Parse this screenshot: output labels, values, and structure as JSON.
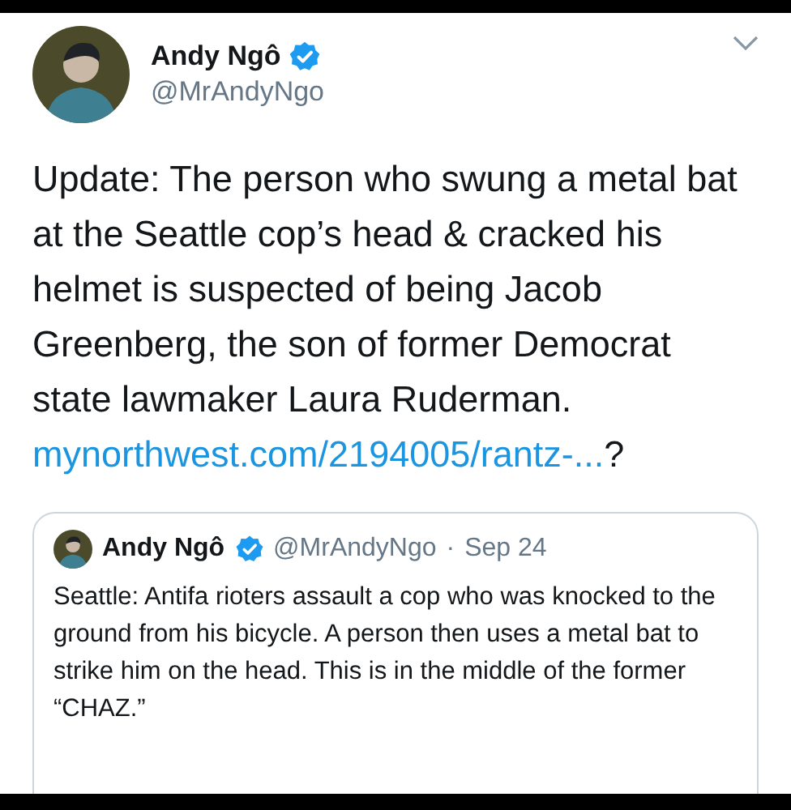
{
  "tweet": {
    "author": {
      "name": "Andy Ngô",
      "handle": "@MrAndyNgo",
      "verified": true
    },
    "text": "Update: The person who swung a metal bat at the Seattle cop’s head & cracked his helmet is suspected of being Jacob Greenberg, the son of former Democrat state lawmaker Laura Ruderman.",
    "link": "mynorthwest.com/2194005/rantz-...",
    "link_suffix": "?",
    "quoted": {
      "name": "Andy Ngô",
      "verified": true,
      "handle": "@MrAndyNgo",
      "separator": "·",
      "date": "Sep 24",
      "text": "Seattle: Antifa rioters assault a cop who was knocked to the ground from his bicycle. A person then uses a metal bat to strike him on the head. This is in the middle of the former “CHAZ.”"
    }
  }
}
